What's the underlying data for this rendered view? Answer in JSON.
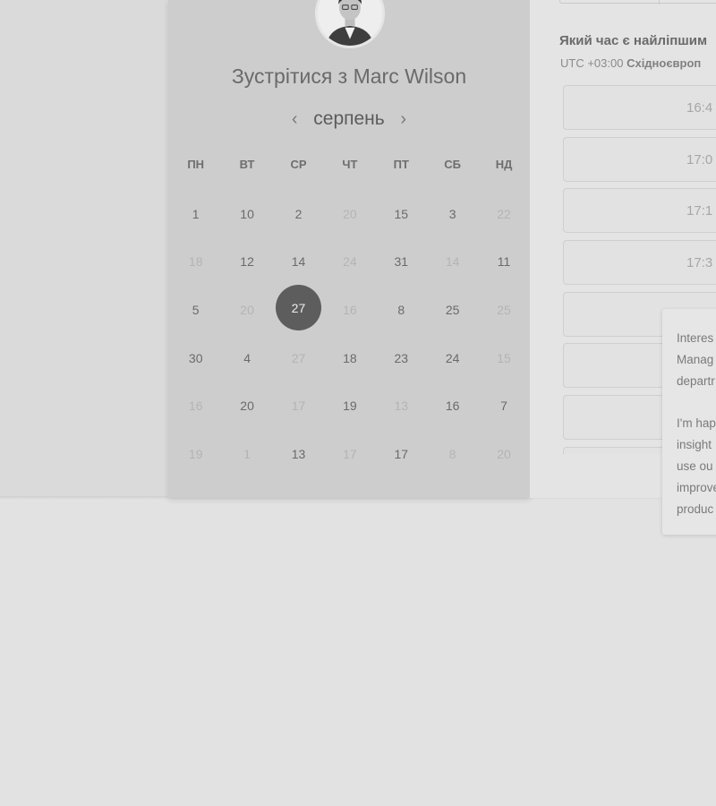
{
  "host": {
    "title": "Зустрітися з Marc Wilson"
  },
  "calendar": {
    "month": "серпень",
    "prev_icon": "chevron-left-icon",
    "next_icon": "chevron-right-icon",
    "weekdays": [
      "ПН",
      "ВТ",
      "СР",
      "ЧТ",
      "ПТ",
      "СБ",
      "НД"
    ],
    "weeks": [
      [
        {
          "d": "1",
          "m": false
        },
        {
          "d": "10",
          "m": false
        },
        {
          "d": "2",
          "m": false
        },
        {
          "d": "20",
          "m": true
        },
        {
          "d": "15",
          "m": false
        },
        {
          "d": "3",
          "m": false
        },
        {
          "d": "22",
          "m": true
        }
      ],
      [
        {
          "d": "18",
          "m": true
        },
        {
          "d": "12",
          "m": false
        },
        {
          "d": "14",
          "m": false
        },
        {
          "d": "24",
          "m": true
        },
        {
          "d": "31",
          "m": false
        },
        {
          "d": "14",
          "m": true
        },
        {
          "d": "11",
          "m": false
        }
      ],
      [
        {
          "d": "5",
          "m": false
        },
        {
          "d": "20",
          "m": true
        },
        {
          "d": "27",
          "m": false,
          "sel": true
        },
        {
          "d": "16",
          "m": true
        },
        {
          "d": "8",
          "m": false
        },
        {
          "d": "25",
          "m": false
        },
        {
          "d": "25",
          "m": true
        }
      ],
      [
        {
          "d": "30",
          "m": false
        },
        {
          "d": "4",
          "m": false
        },
        {
          "d": "27",
          "m": true
        },
        {
          "d": "18",
          "m": false
        },
        {
          "d": "23",
          "m": false
        },
        {
          "d": "24",
          "m": false
        },
        {
          "d": "15",
          "m": true
        }
      ],
      [
        {
          "d": "16",
          "m": true
        },
        {
          "d": "20",
          "m": false
        },
        {
          "d": "17",
          "m": true
        },
        {
          "d": "19",
          "m": false
        },
        {
          "d": "13",
          "m": true
        },
        {
          "d": "16",
          "m": false
        },
        {
          "d": "7",
          "m": false
        }
      ],
      [
        {
          "d": "19",
          "m": true
        },
        {
          "d": "1",
          "m": true
        },
        {
          "d": "13",
          "m": false
        },
        {
          "d": "17",
          "m": true
        },
        {
          "d": "17",
          "m": false
        },
        {
          "d": "8",
          "m": true
        },
        {
          "d": "20",
          "m": true
        }
      ]
    ]
  },
  "schedule": {
    "question": "Який час є найліпшим",
    "timezone_offset": "UTC +03:00",
    "timezone_name": "Східноєвроп",
    "slots": [
      "16:4",
      "17:0",
      "17:1",
      "17:3",
      "",
      "",
      "",
      ""
    ]
  },
  "info_card": {
    "lines1": "Interes\nManag\ndepartr",
    "lines2": "I'm hap\ninsight\nuse ou\nimprove\nproduc"
  }
}
